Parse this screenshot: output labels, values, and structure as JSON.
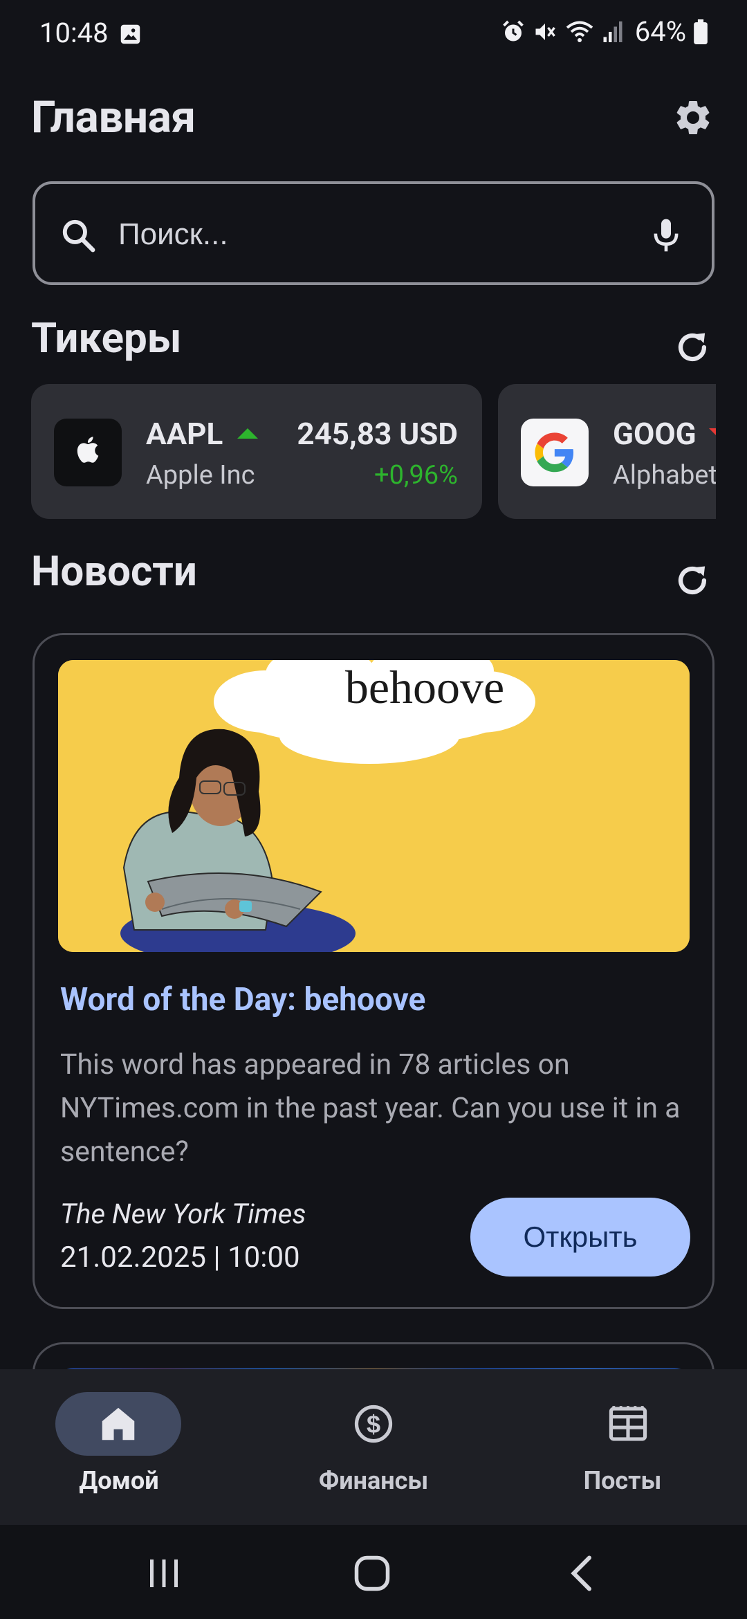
{
  "status_bar": {
    "time": "10:48",
    "battery": "64%"
  },
  "header": {
    "title": "Главная"
  },
  "search": {
    "placeholder": "Поиск..."
  },
  "tickers": {
    "title": "Тикеры",
    "items": [
      {
        "symbol": "AAPL",
        "company": "Apple Inc",
        "price": "245,83 USD",
        "change": "+0,96%",
        "trend": "up",
        "color": "#2db42d"
      },
      {
        "symbol": "GOOG",
        "company": "Alphabet",
        "price": "",
        "change": "",
        "trend": "down",
        "color": "#e53935"
      }
    ]
  },
  "news": {
    "title": "Новости",
    "items": [
      {
        "image_text": "behoove",
        "title": "Word of the Day: behoove",
        "description": "This word has appeared in 78 articles on NYTimes.com in the past year. Can you use it in a sentence?",
        "source": "The New York Times",
        "date": "21.02.2025 | 10:00",
        "open_label": "Открыть"
      }
    ]
  },
  "bottom_nav": {
    "items": [
      {
        "label": "Домой",
        "icon": "home-icon",
        "active": true
      },
      {
        "label": "Финансы",
        "icon": "dollar-icon",
        "active": false
      },
      {
        "label": "Посты",
        "icon": "newspaper-icon",
        "active": false
      }
    ]
  },
  "colors": {
    "accent": "#aac4ff",
    "background": "#121318",
    "card": "#2e2f35",
    "positive": "#2db42d",
    "negative": "#e53935"
  }
}
